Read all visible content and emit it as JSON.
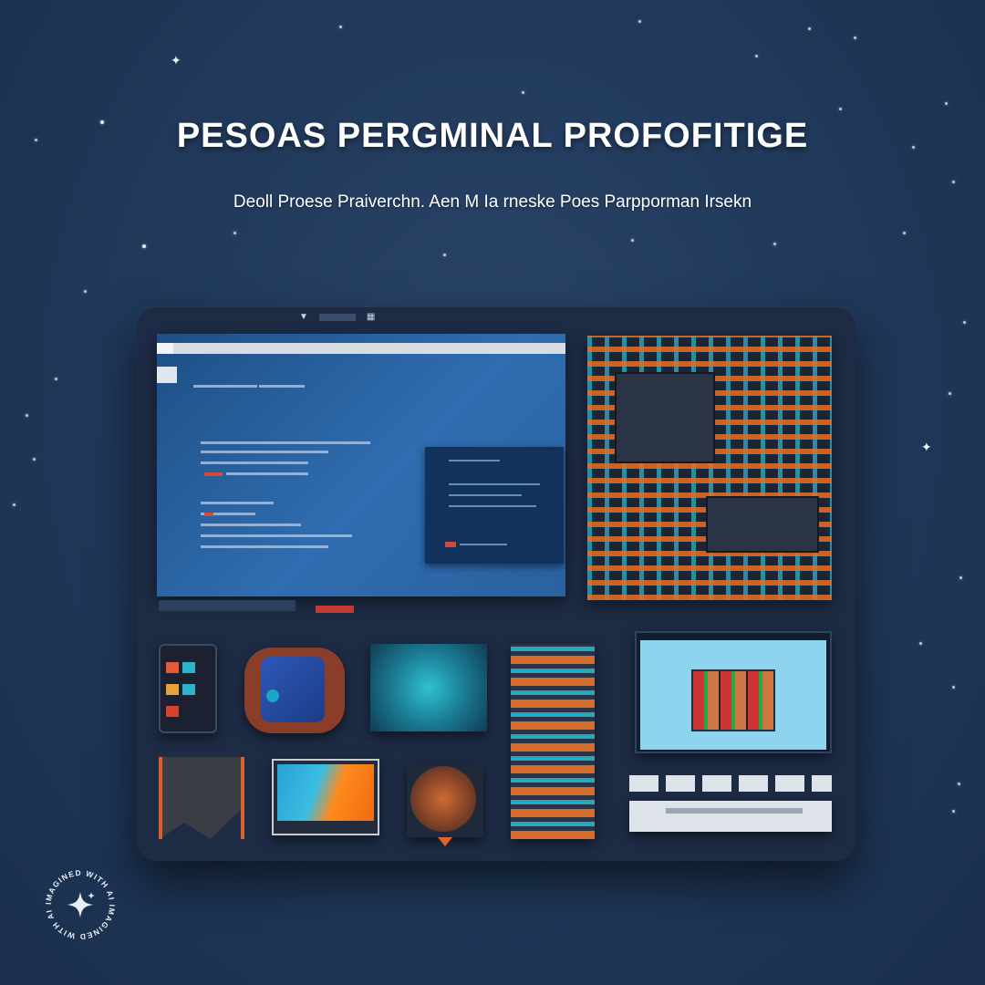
{
  "header": {
    "title": "PESOAS PERGMINAL PROFOFITIGE",
    "subtitle": "Deoll Proese Praiverchn. Aen M Ia rneske Poes Parpporman Irsekn"
  },
  "watermark": {
    "text": "IMAGINED WITH AI IMAGINED WITH AI",
    "icon": "sparkle-icon"
  },
  "colors": {
    "background": "#213a5c",
    "panel": "#1d2b45",
    "accent_orange": "#d86a2b",
    "accent_teal": "#28a8bd",
    "browser_blue": "#2f6db0"
  }
}
